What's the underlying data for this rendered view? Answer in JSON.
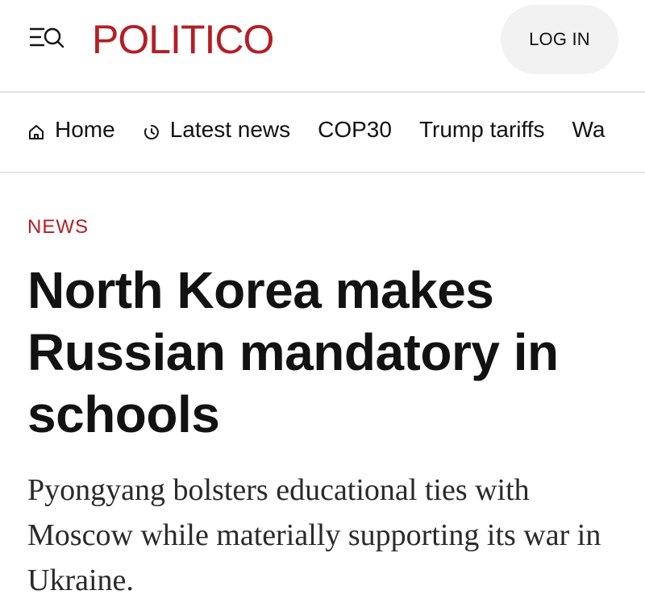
{
  "header": {
    "menu_search_icon": "menu-search-icon",
    "logo_text": "POLITICO",
    "login_label": "LOG IN",
    "brand_color": "#b51e23"
  },
  "nav": {
    "items": [
      {
        "label": "Home",
        "icon": "home-icon"
      },
      {
        "label": "Latest news",
        "icon": "clock-icon"
      },
      {
        "label": "COP30"
      },
      {
        "label": "Trump tariffs"
      },
      {
        "label": "Wa"
      }
    ]
  },
  "article": {
    "kicker": "NEWS",
    "headline": "North Korea makes Russian mandatory in schools",
    "dek": "Pyongyang bolsters educational ties with Moscow while materially supporting its war in Ukraine."
  }
}
